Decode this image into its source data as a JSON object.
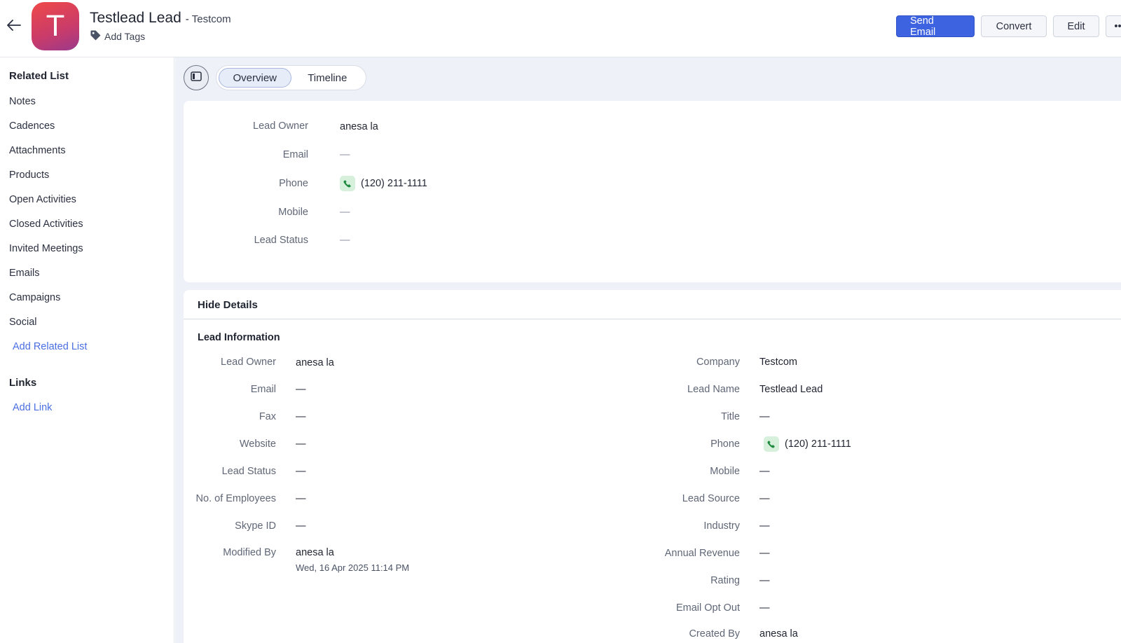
{
  "header": {
    "lead_name": "Testlead Lead",
    "separator": "-",
    "company": "Testcom",
    "avatar_letter": "T",
    "add_tags_label": "Add Tags",
    "buttons": {
      "send_email": "Send Email",
      "convert": "Convert",
      "edit": "Edit",
      "more": "•••"
    }
  },
  "sidebar": {
    "related_list_heading": "Related List",
    "items": [
      {
        "label": "Notes"
      },
      {
        "label": "Cadences"
      },
      {
        "label": "Attachments"
      },
      {
        "label": "Products"
      },
      {
        "label": "Open Activities"
      },
      {
        "label": "Closed Activities"
      },
      {
        "label": "Invited Meetings"
      },
      {
        "label": "Emails"
      },
      {
        "label": "Campaigns"
      },
      {
        "label": "Social"
      }
    ],
    "add_related_list": "Add Related List",
    "links_heading": "Links",
    "add_link": "Add Link"
  },
  "tabs": {
    "overview": "Overview",
    "timeline": "Timeline",
    "active": "Overview"
  },
  "overview": {
    "fields": [
      {
        "label": "Lead Owner",
        "value": "anesa la"
      },
      {
        "label": "Email",
        "value": "—"
      },
      {
        "label": "Phone",
        "value": "(120) 211-1111"
      },
      {
        "label": "Mobile",
        "value": "—"
      },
      {
        "label": "Lead Status",
        "value": "—"
      }
    ]
  },
  "details": {
    "hide_details_label": "Hide Details",
    "section_title": "Lead Information",
    "left": [
      {
        "label": "Lead Owner",
        "value": "anesa la"
      },
      {
        "label": "Email",
        "value": "—"
      },
      {
        "label": "Fax",
        "value": "—"
      },
      {
        "label": "Website",
        "value": "—"
      },
      {
        "label": "Lead Status",
        "value": "—"
      },
      {
        "label": "No. of Employees",
        "value": "—"
      },
      {
        "label": "Skype ID",
        "value": "—"
      },
      {
        "label": "Modified By",
        "value": "anesa la",
        "sub": "Wed, 16 Apr 2025 11:14 PM"
      }
    ],
    "right": [
      {
        "label": "Company",
        "value": "Testcom"
      },
      {
        "label": "Lead Name",
        "value": "Testlead Lead"
      },
      {
        "label": "Title",
        "value": "—"
      },
      {
        "label": "Phone",
        "value": "(120) 211-1111"
      },
      {
        "label": "Mobile",
        "value": "—"
      },
      {
        "label": "Lead Source",
        "value": "—"
      },
      {
        "label": "Industry",
        "value": "—"
      },
      {
        "label": "Annual Revenue",
        "value": "—"
      },
      {
        "label": "Rating",
        "value": "—"
      },
      {
        "label": "Email Opt Out",
        "value": "—"
      },
      {
        "label": "Created By",
        "value": "anesa la"
      }
    ]
  },
  "colors": {
    "accent": "#3d63e0",
    "link": "#4a6fe3",
    "avatar_gradient_start": "#ef4a48",
    "avatar_gradient_end": "#9a3a8c",
    "phone_badge": "#d6f0dc",
    "main_background": "#eef1f8"
  }
}
